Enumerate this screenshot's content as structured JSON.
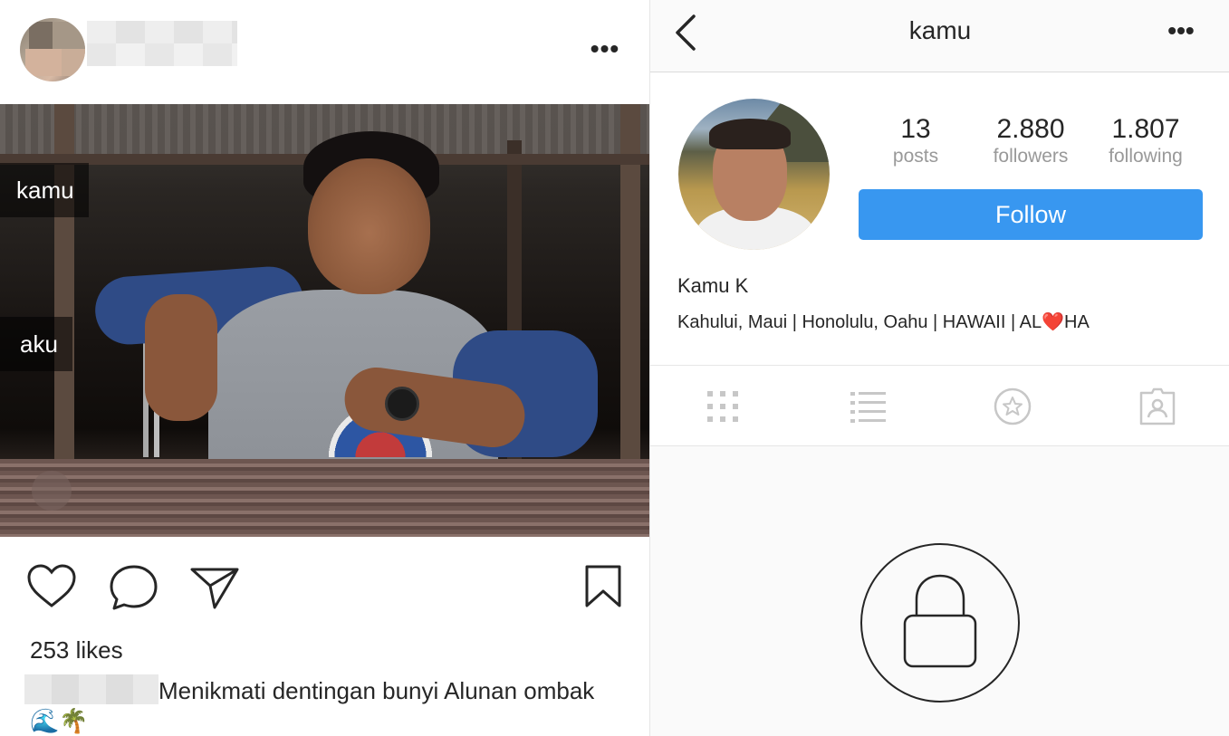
{
  "post": {
    "more_label": "•••",
    "tags": {
      "kamu": "kamu",
      "aku": "aku"
    },
    "likes": "253 likes",
    "caption_text": "Menikmati dentingan bunyi Alunan ombak🌊🌴"
  },
  "profile": {
    "title": "kamu",
    "more_label": "•••",
    "stats": [
      {
        "num": "13",
        "label": "posts"
      },
      {
        "num": "2.880",
        "label": "followers"
      },
      {
        "num": "1.807",
        "label": "following"
      }
    ],
    "follow_label": "Follow",
    "display_name": "Kamu K",
    "bio_before": "Kahului, Maui | Honolulu, Oahu | HAWAII | AL",
    "bio_heart": "❤️",
    "bio_after": "HA"
  },
  "colors": {
    "accent": "#3897f0",
    "text": "#262626",
    "muted": "#999999"
  },
  "icons": {
    "left": [
      "heart-icon",
      "comment-icon",
      "share-icon",
      "bookmark-icon"
    ],
    "right": [
      "back-icon",
      "more-icon",
      "grid-icon",
      "list-icon",
      "tagged-star-icon",
      "tagged-person-icon",
      "lock-icon"
    ]
  }
}
